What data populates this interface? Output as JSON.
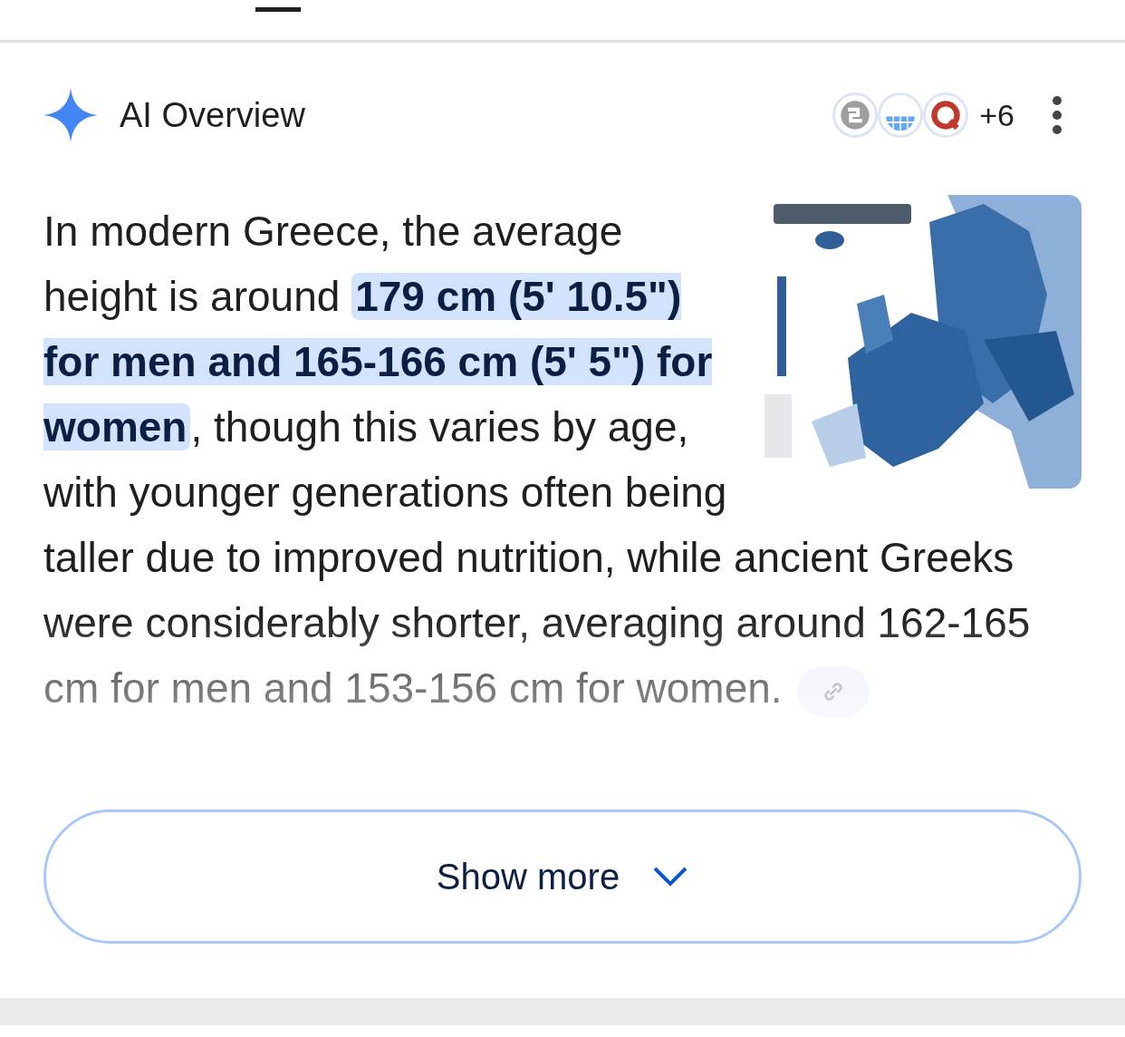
{
  "overview": {
    "title": "AI Overview",
    "source_count": "+6",
    "paragraph": "In modern Greece, the average height is around **179 cm (5' 10.5\") for men and 165-166 cm (5' 5\") for women**, though this varies by age, with younger generations often being taller due to improved nutrition, while ancient Greeks were considerably shorter, averaging around 162-165 cm for men and 153-156 cm for women."
  },
  "show_more": {
    "label": "Show more"
  }
}
